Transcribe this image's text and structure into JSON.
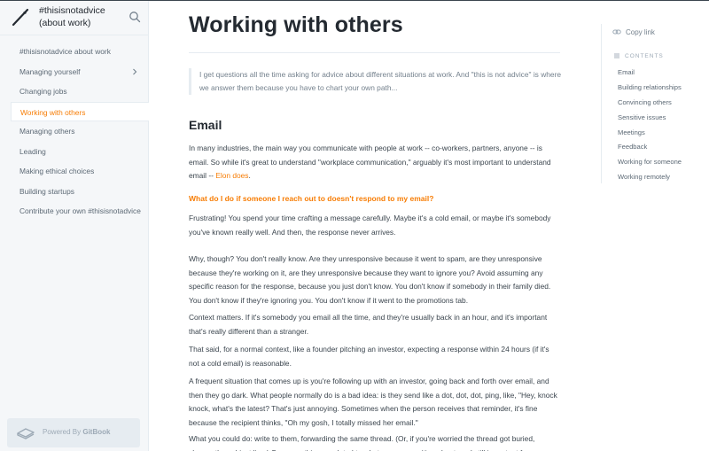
{
  "brand": {
    "title": "#thisisnotadvice (about work)"
  },
  "sidebar": {
    "items": [
      {
        "label": "#thisisnotadvice about work"
      },
      {
        "label": "Managing yourself"
      },
      {
        "label": "Changing jobs"
      },
      {
        "label": "Working with others"
      },
      {
        "label": "Managing others"
      },
      {
        "label": "Leading"
      },
      {
        "label": "Making ethical choices"
      },
      {
        "label": "Building startups"
      },
      {
        "label": "Contribute your own #thisisnotadvice"
      }
    ],
    "footer": {
      "prefix": "Powered By ",
      "brand": "GitBook"
    }
  },
  "main": {
    "title": "Working with others",
    "intro": "I get questions all the time asking for advice about different situations at work. And \"this is not advice\" is where we answer them because you have to chart your own path...",
    "section_title": "Email",
    "section_p1_text": "In many industries, the main way you communicate with people at work -- co-workers, partners, anyone -- is email. So while it's great to understand \"workplace communication,\" arguably it's most important to understand email -- ",
    "section_p1_link": "Elon does",
    "section_p1_end": ".",
    "question": "What do I do if someone I reach out to doesn't respond to my email?",
    "paragraphs": [
      "Frustrating! You spend your time crafting a message carefully. Maybe it's a cold email, or maybe it's somebody you've known really well. And then, the response never arrives.",
      "Why, though? You don't really know. Are they unresponsive because it went to spam, are they unresponsive because they're working on it, are they unresponsive because they want to ignore you? Avoid assuming any specific reason for the response, because you just don't know. You don't know if somebody in their family died. You don't know if they're ignoring you. You don't know if it went to the promotions tab.",
      "Context matters. If it's somebody you email all the time, and they're usually back in an hour, and it's important that's really different than a stranger.",
      "That said, for a normal context, like a founder pitching an investor, expecting a response within 24 hours (if it's not a cold email) is reasonable.",
      "A frequent situation that comes up is you're following up with an investor, going back and forth over email, and then they go dark. What people normally do is a bad idea: is they send like a dot, dot, dot, ping, like, \"Hey, knock knock, what's the latest? That's just annoying. Sometimes when the person receives that reminder, it's fine because the recipient thinks, \"Oh my gosh, I totally missed her email.\"",
      "What you could do: write to them, forwarding the same thread. (Or, if you're worried the thread got buried, change the subject line.) Say something unrelated to what you were writing about, and still important for"
    ]
  },
  "toc": {
    "copy_link": "Copy link",
    "heading": "CONTENTS",
    "items": [
      {
        "label": "Email"
      },
      {
        "label": "Building relationships"
      },
      {
        "label": "Convincing others"
      },
      {
        "label": "Sensitive issues"
      },
      {
        "label": "Meetings"
      },
      {
        "label": "Feedback"
      },
      {
        "label": "Working for someone"
      },
      {
        "label": "Working remotely"
      }
    ]
  },
  "colors": {
    "accent": "#f77d05",
    "sidebar_bg": "#f5f7f9",
    "text": "#3b454e",
    "heading": "#242a31"
  }
}
